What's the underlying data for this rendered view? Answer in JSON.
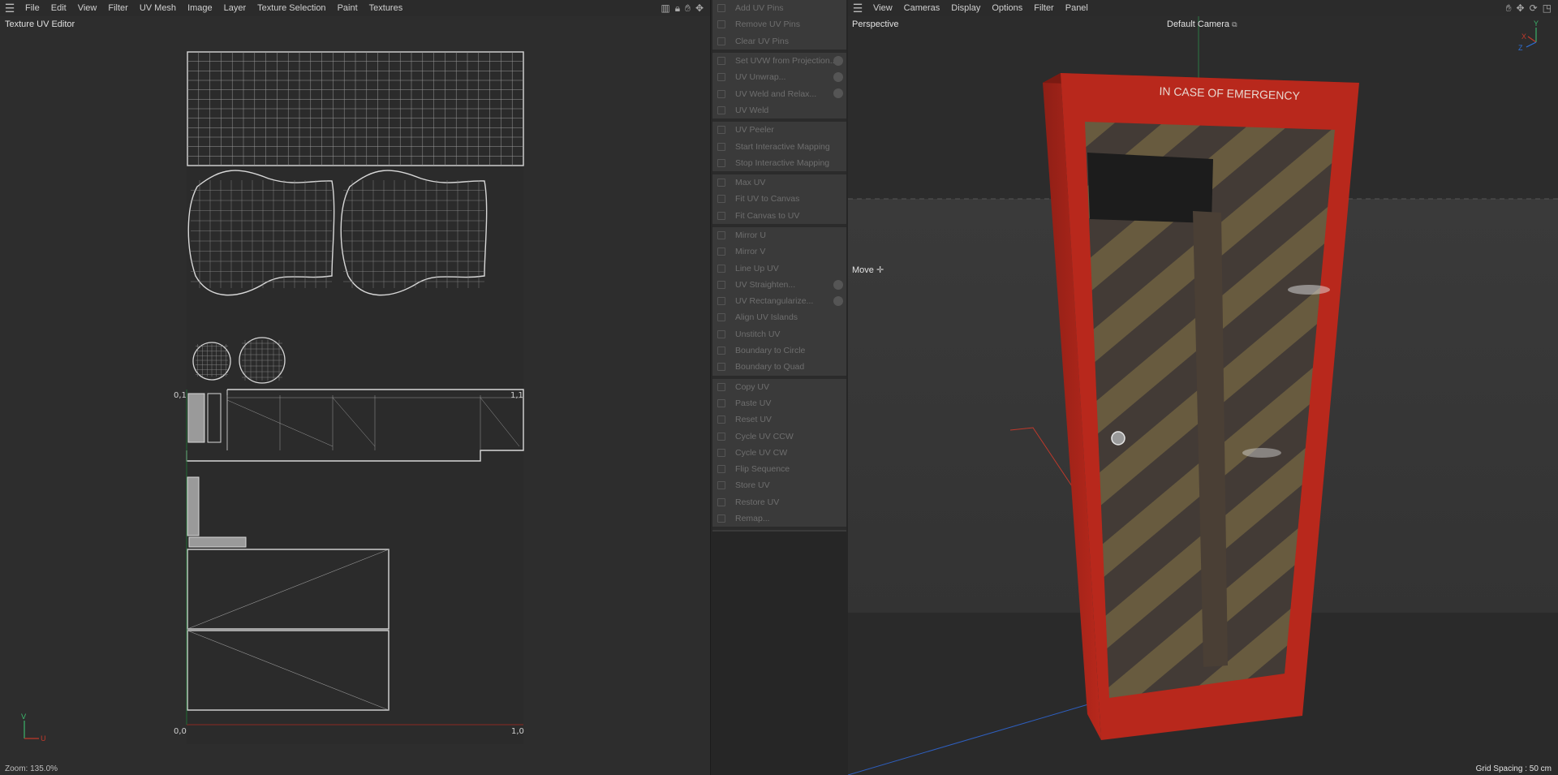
{
  "uv_editor": {
    "menu": [
      "File",
      "Edit",
      "View",
      "Filter",
      "UV Mesh",
      "Image",
      "Layer",
      "Texture Selection",
      "Paint",
      "Textures"
    ],
    "title": "Texture UV Editor",
    "zoom": "Zoom: 135.0%",
    "corner_labels": {
      "top_left": "0,1",
      "top_right": "1,1",
      "bottom_left": "0,0",
      "bottom_right": "1,0"
    },
    "axis_labels": {
      "u": "U",
      "v": "V"
    }
  },
  "commands": {
    "groups": [
      [
        {
          "label": "Add UV Pins",
          "icon": "pin-icon"
        },
        {
          "label": "Remove UV Pins",
          "icon": "unpin-icon"
        },
        {
          "label": "Clear UV Pins",
          "icon": "clear-icon"
        }
      ],
      [
        {
          "label": "Set UVW from Projection...",
          "icon": "projection-icon",
          "gear": true
        },
        {
          "label": "UV Unwrap...",
          "icon": "unwrap-icon",
          "gear": true
        },
        {
          "label": "UV Weld and Relax...",
          "icon": "relax-icon",
          "gear": true
        },
        {
          "label": "UV Weld",
          "icon": "weld-icon"
        }
      ],
      [
        {
          "label": "UV Peeler",
          "icon": "peeler-icon"
        },
        {
          "label": "Start Interactive Mapping",
          "icon": "play-icon"
        },
        {
          "label": "Stop Interactive Mapping",
          "icon": "stop-icon"
        }
      ],
      [
        {
          "label": "Max UV",
          "icon": "max-icon"
        },
        {
          "label": "Fit UV to Canvas",
          "icon": "fit-icon"
        },
        {
          "label": "Fit Canvas to UV",
          "icon": "fit-canvas-icon"
        }
      ],
      [
        {
          "label": "Mirror U",
          "icon": "mirror-u-icon"
        },
        {
          "label": "Mirror V",
          "icon": "mirror-v-icon"
        },
        {
          "label": "Line Up UV",
          "icon": "lineup-icon"
        },
        {
          "label": "UV Straighten...",
          "icon": "straighten-icon",
          "gear": true
        },
        {
          "label": "UV Rectangularize...",
          "icon": "rectangularize-icon",
          "gear": true
        },
        {
          "label": "Align UV Islands",
          "icon": "align-icon"
        },
        {
          "label": "Unstitch UV",
          "icon": "unstitch-icon"
        },
        {
          "label": "Boundary to Circle",
          "icon": "circle-icon"
        },
        {
          "label": "Boundary to Quad",
          "icon": "quad-icon"
        }
      ],
      [
        {
          "label": "Copy UV",
          "icon": "copy-icon"
        },
        {
          "label": "Paste UV",
          "icon": "paste-icon"
        },
        {
          "label": "Reset UV",
          "icon": "reset-icon"
        },
        {
          "label": "Cycle UV CCW",
          "icon": "ccw-icon"
        },
        {
          "label": "Cycle UV CW",
          "icon": "cw-icon"
        },
        {
          "label": "Flip Sequence",
          "icon": "flip-icon"
        },
        {
          "label": "Store UV",
          "icon": "store-icon"
        },
        {
          "label": "Restore UV",
          "icon": "restore-icon"
        },
        {
          "label": "Remap...",
          "icon": "remap-icon"
        }
      ]
    ]
  },
  "viewport": {
    "menu": [
      "View",
      "Cameras",
      "Display",
      "Options",
      "Filter",
      "Panel"
    ],
    "projection": "Perspective",
    "camera": "Default Camera",
    "tool": "Move",
    "grid_spacing": "Grid Spacing : 50 cm",
    "sign_text": "IN CASE OF EMERGENCY",
    "axis_labels": {
      "x": "X",
      "y": "Y",
      "z": "Z"
    }
  },
  "colors": {
    "cabinet_red": "#b8281c",
    "u_axis": "#c0392b",
    "v_axis": "#27ae60",
    "z_axis": "#2e6fd6"
  }
}
